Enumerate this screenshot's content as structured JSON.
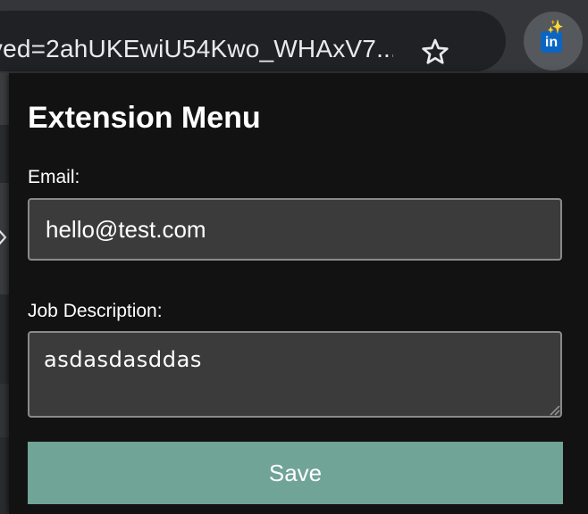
{
  "browser": {
    "url": "&ved=2ahUKEwiU54Kwo_WHAxV7..."
  },
  "extension": {
    "badge_text": "in",
    "sparkle": "✨",
    "badge_color": "#0a66c2"
  },
  "popup": {
    "title": "Extension Menu",
    "email_label": "Email:",
    "email_value": "hello@test.com",
    "job_description_label": "Job Description:",
    "job_description_value": "asdasdasddas",
    "save_label": "Save",
    "save_color": "#6fa497",
    "background_color": "#121212"
  }
}
